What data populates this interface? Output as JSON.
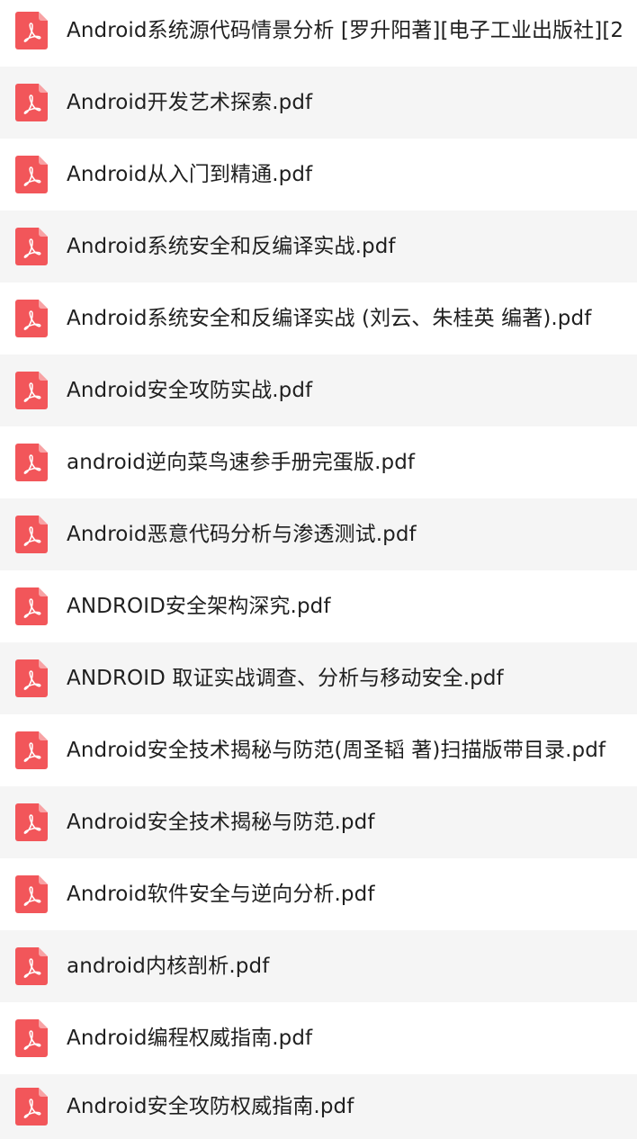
{
  "theme": {
    "icon_color": "#f2565a",
    "row_alt_background": "#f5f5f5",
    "row_background": "#ffffff",
    "text_color": "#1f1f1f"
  },
  "files": [
    {
      "name": "Android系统源代码情景分析 [罗升阳著][电子工业出版社][2",
      "icon": "pdf-file-icon"
    },
    {
      "name": "Android开发艺术探索.pdf",
      "icon": "pdf-file-icon"
    },
    {
      "name": "Android从入门到精通.pdf",
      "icon": "pdf-file-icon"
    },
    {
      "name": "Android系统安全和反编译实战.pdf",
      "icon": "pdf-file-icon"
    },
    {
      "name": "Android系统安全和反编译实战 (刘云、朱桂英 编著).pdf",
      "icon": "pdf-file-icon"
    },
    {
      "name": "Android安全攻防实战.pdf",
      "icon": "pdf-file-icon"
    },
    {
      "name": "android逆向菜鸟速参手册完蛋版.pdf",
      "icon": "pdf-file-icon"
    },
    {
      "name": "Android恶意代码分析与渗透测试.pdf",
      "icon": "pdf-file-icon"
    },
    {
      "name": "ANDROID安全架构深究.pdf",
      "icon": "pdf-file-icon"
    },
    {
      "name": "ANDROID 取证实战调查、分析与移动安全.pdf",
      "icon": "pdf-file-icon"
    },
    {
      "name": "Android安全技术揭秘与防范(周圣韬 著)扫描版带目录.pdf",
      "icon": "pdf-file-icon"
    },
    {
      "name": "Android安全技术揭秘与防范.pdf",
      "icon": "pdf-file-icon"
    },
    {
      "name": "Android软件安全与逆向分析.pdf",
      "icon": "pdf-file-icon"
    },
    {
      "name": "android内核剖析.pdf",
      "icon": "pdf-file-icon"
    },
    {
      "name": "Android编程权威指南.pdf",
      "icon": "pdf-file-icon"
    },
    {
      "name": "Android安全攻防权威指南.pdf",
      "icon": "pdf-file-icon"
    }
  ]
}
